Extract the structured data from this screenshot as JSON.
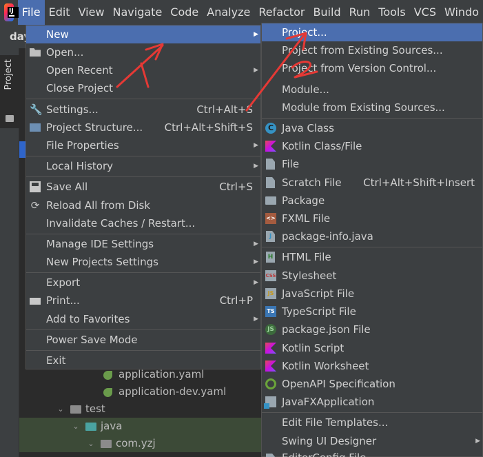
{
  "menubar": {
    "project_short": "day",
    "items": [
      {
        "label": "File",
        "underline": "F"
      },
      {
        "label": "Edit"
      },
      {
        "label": "View"
      },
      {
        "label": "Navigate"
      },
      {
        "label": "Code"
      },
      {
        "label": "Analyze"
      },
      {
        "label": "Refactor"
      },
      {
        "label": "Build"
      },
      {
        "label": "Run"
      },
      {
        "label": "Tools"
      },
      {
        "label": "VCS"
      },
      {
        "label": "Windo"
      }
    ]
  },
  "left_panel": {
    "project_label": "Project"
  },
  "file_menu": {
    "new": "New",
    "open": "Open...",
    "open_recent": "Open Recent",
    "close_project": "Close Project",
    "settings": "Settings...",
    "settings_shortcut": "Ctrl+Alt+S",
    "project_structure": "Project Structure...",
    "project_structure_shortcut": "Ctrl+Alt+Shift+S",
    "file_properties": "File Properties",
    "local_history": "Local History",
    "save_all": "Save All",
    "save_all_shortcut": "Ctrl+S",
    "reload_all": "Reload All from Disk",
    "invalidate_caches": "Invalidate Caches / Restart...",
    "manage_ide_settings": "Manage IDE Settings",
    "new_projects_settings": "New Projects Settings",
    "export": "Export",
    "print": "Print...",
    "print_shortcut": "Ctrl+P",
    "add_to_favorites": "Add to Favorites",
    "power_save_mode": "Power Save Mode",
    "exit": "Exit"
  },
  "new_menu": {
    "project": "Project...",
    "project_existing": "Project from Existing Sources...",
    "project_vcs": "Project from Version Control...",
    "module": "Module...",
    "module_existing": "Module from Existing Sources...",
    "java_class": "Java Class",
    "kotlin_class": "Kotlin Class/File",
    "file": "File",
    "scratch_file": "Scratch File",
    "scratch_shortcut": "Ctrl+Alt+Shift+Insert",
    "package": "Package",
    "fxml_file": "FXML File",
    "package_info": "package-info.java",
    "html_file": "HTML File",
    "stylesheet": "Stylesheet",
    "javascript_file": "JavaScript File",
    "typescript_file": "TypeScript File",
    "package_json": "package.json File",
    "kotlin_script": "Kotlin Script",
    "kotlin_worksheet": "Kotlin Worksheet",
    "openapi_spec": "OpenAPI Specification",
    "javafx_app": "JavaFXApplication",
    "edit_templates": "Edit File Templates...",
    "swing_designer": "Swing UI Designer",
    "editorconfig": "EditorConfig File"
  },
  "tree": {
    "application_yaml": "application.yaml",
    "application_dev_yaml": "application-dev.yaml",
    "test": "test",
    "java": "java",
    "com_yzj": "com.yzj"
  },
  "annotations": {
    "mark1": "1",
    "mark2": "2",
    "color": "#e53935"
  },
  "colors": {
    "accent": "#4b6eaf",
    "menu_bg": "#3c3f41",
    "editor_bg": "#2b2b2b"
  }
}
